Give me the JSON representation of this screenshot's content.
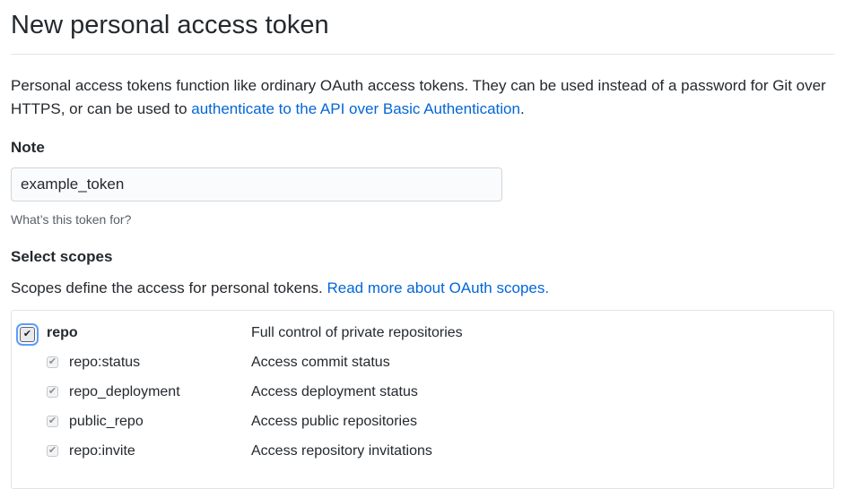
{
  "page": {
    "title": "New personal access token",
    "intro_text": "Personal access tokens function like ordinary OAuth access tokens. They can be used instead of a password for Git over HTTPS, or can be used to ",
    "intro_link": "authenticate to the API over Basic Authentication",
    "intro_end": "."
  },
  "note": {
    "label": "Note",
    "value": "example_token",
    "hint": "What’s this token for?"
  },
  "scopes": {
    "label": "Select scopes",
    "description": "Scopes define the access for personal tokens. ",
    "link": "Read more about OAuth scopes.",
    "items": [
      {
        "name": "repo",
        "description": "Full control of private repositories",
        "checked": true
      },
      {
        "name": "repo:status",
        "description": "Access commit status",
        "checked": true
      },
      {
        "name": "repo_deployment",
        "description": "Access deployment status",
        "checked": true
      },
      {
        "name": "public_repo",
        "description": "Access public repositories",
        "checked": true
      },
      {
        "name": "repo:invite",
        "description": "Access repository invitations",
        "checked": true
      }
    ]
  },
  "colors": {
    "link": "#0366d6",
    "text": "#24292e",
    "muted": "#586069",
    "border": "#e1e4e8",
    "focus_ring": "#5b9dfd"
  },
  "icons": {
    "checkbox": "checkmark-icon"
  }
}
